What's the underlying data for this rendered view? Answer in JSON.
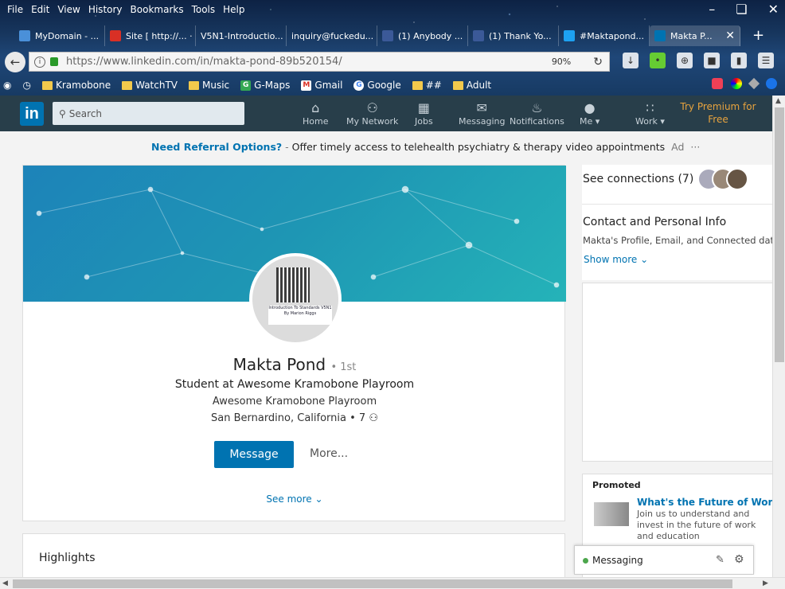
{
  "browser": {
    "menu": [
      "File",
      "Edit",
      "View",
      "History",
      "Bookmarks",
      "Tools",
      "Help"
    ],
    "tabs": [
      {
        "label": "MyDomain - ...",
        "color": "#4a90d9"
      },
      {
        "label": "Site [ http://... ·",
        "color": "#d93025"
      },
      {
        "label": "V5N1-Introductio...",
        "color": "#1a73e8"
      },
      {
        "label": "inquiry@fuckedu...",
        "color": "#1a73e8"
      },
      {
        "label": "(1) Anybody ...",
        "color": "#3b5998"
      },
      {
        "label": "(1) Thank Yo...",
        "color": "#3b5998"
      },
      {
        "label": "#Maktapond...",
        "color": "#1da1f2"
      },
      {
        "label": "Makta P...",
        "color": "#0073b1"
      }
    ],
    "url": "https://www.linkedin.com/in/makta-pond-89b520154/",
    "zoom": "90%",
    "bookmarks": [
      {
        "label": "Kramobone",
        "kind": "folder"
      },
      {
        "label": "WatchTV",
        "kind": "folder"
      },
      {
        "label": "Music",
        "kind": "folder"
      },
      {
        "label": "G-Maps",
        "kind": "maps"
      },
      {
        "label": "Gmail",
        "kind": "gmail"
      },
      {
        "label": "Google",
        "kind": "google"
      },
      {
        "label": "##",
        "kind": "folder"
      },
      {
        "label": "Adult",
        "kind": "folder"
      }
    ]
  },
  "nav": {
    "logo": "in",
    "search_placeholder": "Search",
    "items": [
      "Home",
      "My Network",
      "Jobs",
      "Messaging",
      "Notifications",
      "Me",
      "Work"
    ],
    "premium": "Try Premium for Free"
  },
  "ad": {
    "link": "Need Referral Options?",
    "sep": " - ",
    "text": "Offer timely access to telehealth psychiatry & therapy video appointments",
    "tag": "Ad",
    "more": "···"
  },
  "profile": {
    "name": "Makta Pond",
    "degree": "• 1st",
    "headline": "Student at Awesome Kramobone Playroom",
    "company": "Awesome Kramobone Playroom",
    "location": "San Bernardino, California",
    "connections": "7",
    "avatar_caption": "Introduction To Standards V5N1 By Marion Riggs",
    "message_btn": "Message",
    "more_btn": "More...",
    "see_more": "See more"
  },
  "highlights": {
    "title": "Highlights"
  },
  "sidebar": {
    "connections": "See connections (7)",
    "contact_title": "Contact and Personal Info",
    "contact_sub": "Makta's Profile, Email, and Connected date",
    "show_more": "Show more",
    "promoted": "Promoted",
    "promo_title": "What's the Future of Work",
    "promo_body": "Join us to understand and invest in the future of work and education"
  },
  "messaging": {
    "label": "Messaging"
  },
  "colors": {
    "brand": "#0073b1",
    "nav": "#283e4a"
  }
}
